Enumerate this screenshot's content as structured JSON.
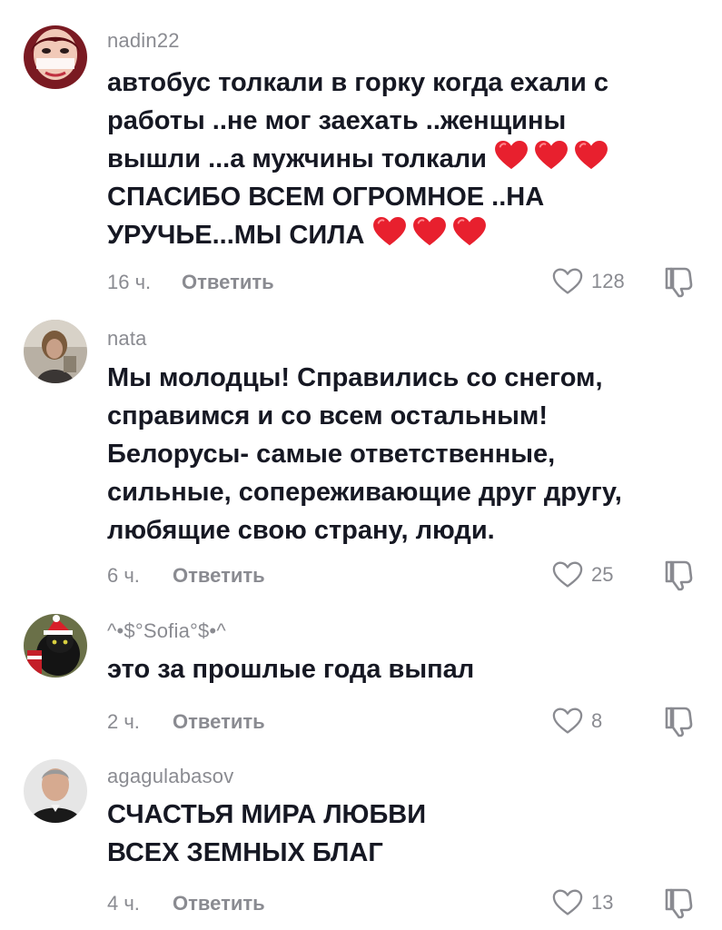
{
  "comments": [
    {
      "username": "nadin22",
      "line1": "автобус толкали в горку когда ехали с\nработы ..не мог заехать ..женщины\nвышли ...а мужчины толкали ",
      "line2": "\nСПАСИБО ВСЕМ ОГРОМНОЕ ..НА\nУРУЧЬЕ...МЫ СИЛА ",
      "time": "16 ч.",
      "reply_label": "Ответить",
      "likes": "128"
    },
    {
      "username": "nata",
      "text": "Мы молодцы! Справились со снегом,\nсправимся и со всем остальным!\nБелорусы- самые ответственные,\nсильные, сопереживающие друг другу,\nлюбящие свою страну, люди.",
      "time": "6 ч.",
      "reply_label": "Ответить",
      "likes": "25"
    },
    {
      "username": "^•$°Sofia°$•^",
      "text": "это за прошлые года выпал",
      "time": "2 ч.",
      "reply_label": "Ответить",
      "likes": "8"
    },
    {
      "username": "agagulabasov",
      "text": "СЧАСТЬЯ МИРА ЛЮБВИ\nВСЕХ ЗЕМНЫХ БЛАГ",
      "time": "4 ч.",
      "reply_label": "Ответить",
      "likes": "13"
    }
  ],
  "icons": {
    "like": "heart-outline-icon",
    "dislike": "thumbs-down-icon",
    "emoji": "red-heart-emoji"
  },
  "colors": {
    "text": "#161823",
    "muted": "#8a8b91",
    "heart_emoji": "#e8202e"
  }
}
